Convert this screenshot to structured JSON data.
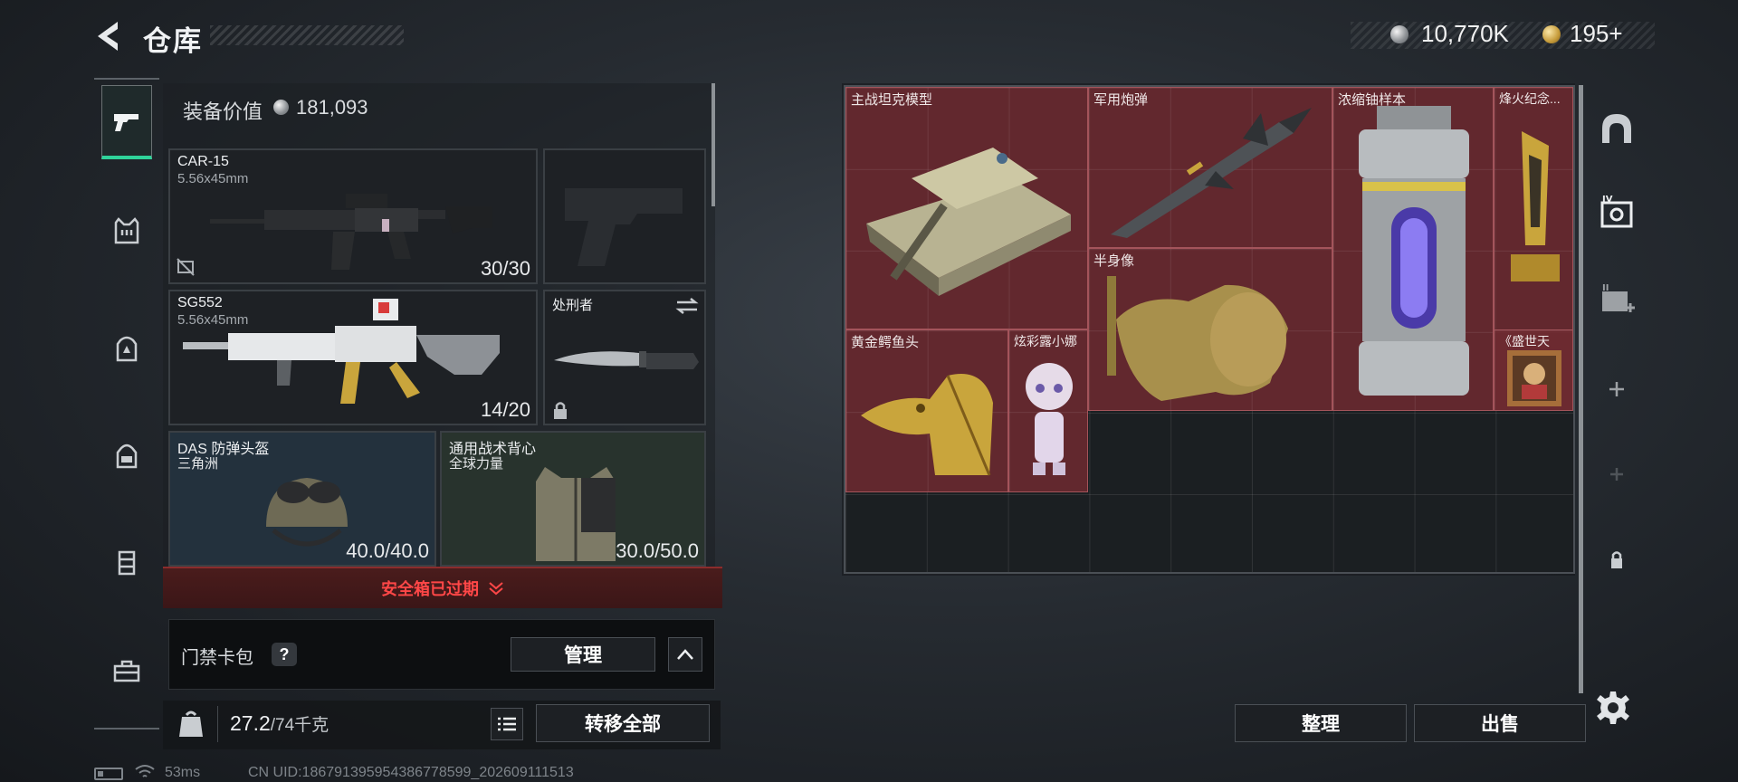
{
  "header": {
    "title": "仓库",
    "silver_amount": "10,770K",
    "gold_amount": "195+"
  },
  "loadout": {
    "value_label": "装备价值",
    "value_amount": "181,093",
    "slots": {
      "primary": {
        "name": "CAR-15",
        "caliber": "5.56x45mm",
        "ammo": "30/30"
      },
      "secondary": {
        "name": "SG552",
        "caliber": "5.56x45mm",
        "ammo": "14/20"
      },
      "melee": {
        "name": "处刑者"
      },
      "helmet": {
        "name": "DAS 防弹头盔",
        "sub": "三角洲",
        "durability": "40.0/40.0"
      },
      "vest": {
        "name": "通用战术背心",
        "sub": "全球力量",
        "durability": "30.0/50.0"
      }
    },
    "safebox_text": "安全箱已过期",
    "card_pack_label": "门禁卡包",
    "help_label": "?",
    "manage_label": "管理",
    "weight_current": "27.2",
    "weight_max": "/74千克",
    "transfer_all_label": "转移全部"
  },
  "storage": {
    "items": [
      {
        "name": "主战坦克模型"
      },
      {
        "name": "军用炮弹"
      },
      {
        "name": "浓缩铀样本"
      },
      {
        "name": "烽火纪念..."
      },
      {
        "name": "半身像"
      },
      {
        "name": "黄金鳄鱼头"
      },
      {
        "name": "炫彩露小娜"
      },
      {
        "name": "《盛世天"
      }
    ],
    "sort_label": "整理",
    "sell_label": "出售"
  },
  "status": {
    "ping": "53ms",
    "uid": "CN UID:186791395954386778599_202609111513"
  },
  "colors": {
    "accent": "#2fd39a",
    "alert": "#ff4747",
    "item_highlight": "#6e2a30"
  }
}
